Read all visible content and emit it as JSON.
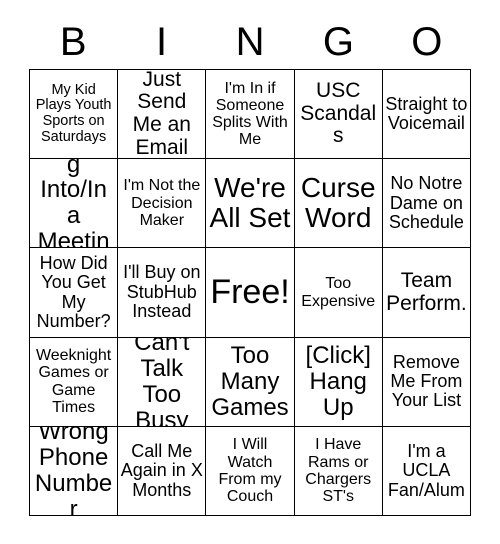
{
  "header": {
    "letters": [
      "B",
      "I",
      "N",
      "G",
      "O"
    ]
  },
  "grid": {
    "rows": [
      [
        {
          "text": "My Kid Plays Youth Sports on Saturdays",
          "size": "fs-xs"
        },
        {
          "text": "Just Send Me an Email",
          "size": "fs-lg"
        },
        {
          "text": "I'm In if Someone Splits With Me",
          "size": "fs-sm"
        },
        {
          "text": "USC Scandals",
          "size": "fs-lg"
        },
        {
          "text": "Straight to Voicemail",
          "size": "fs-md"
        }
      ],
      [
        {
          "text": "Running Into/In a Meeting",
          "size": "fs-xl"
        },
        {
          "text": "I'm Not the Decision Maker",
          "size": "fs-sm"
        },
        {
          "text": "We're All Set",
          "size": "fs-xxl"
        },
        {
          "text": "Curse Word",
          "size": "fs-xxl"
        },
        {
          "text": "No Notre Dame on Schedule",
          "size": "fs-md"
        }
      ],
      [
        {
          "text": "How Did You Get My Number?",
          "size": "fs-md"
        },
        {
          "text": "I'll Buy on StubHub Instead",
          "size": "fs-md"
        },
        {
          "text": "Free!",
          "size": "fs-free"
        },
        {
          "text": "Too Expensive",
          "size": "fs-sm"
        },
        {
          "text": "Team Perform.",
          "size": "fs-lg"
        }
      ],
      [
        {
          "text": "Weeknight Games or Game Times",
          "size": "fs-sm"
        },
        {
          "text": "Can't Talk Too Busy",
          "size": "fs-xl"
        },
        {
          "text": "Too Many Games",
          "size": "fs-xl"
        },
        {
          "text": "[Click] Hang Up",
          "size": "fs-xl"
        },
        {
          "text": "Remove Me From Your List",
          "size": "fs-md"
        }
      ],
      [
        {
          "text": "Wrong Phone Number",
          "size": "fs-xl"
        },
        {
          "text": "Call Me Again in X Months",
          "size": "fs-md"
        },
        {
          "text": "I Will Watch From my Couch",
          "size": "fs-sm"
        },
        {
          "text": "I Have Rams or Chargers ST's",
          "size": "fs-sm"
        },
        {
          "text": "I'm a UCLA Fan/Alum",
          "size": "fs-md"
        }
      ]
    ]
  }
}
